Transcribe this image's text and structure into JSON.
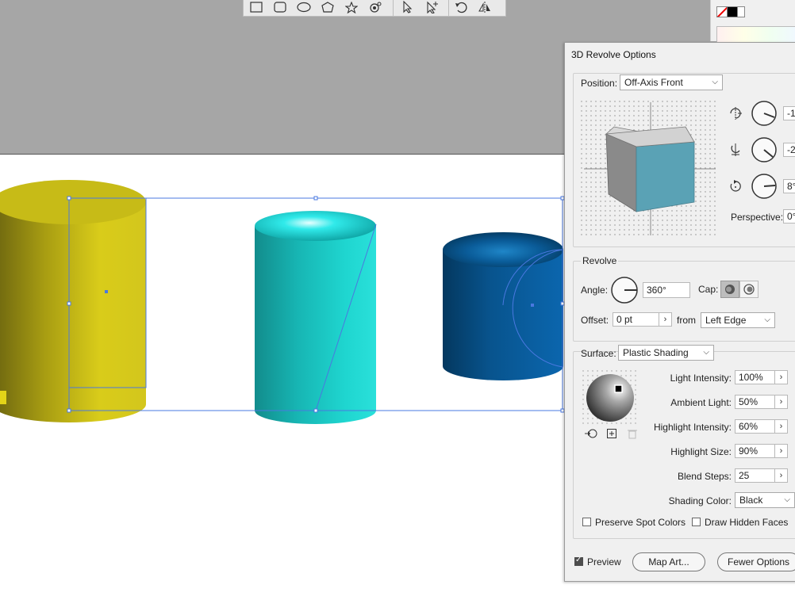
{
  "toolbar": {
    "tools": [
      {
        "icon": "rectangle-icon"
      },
      {
        "icon": "rounded-rectangle-icon"
      },
      {
        "icon": "ellipse-icon"
      },
      {
        "icon": "polygon-icon"
      },
      {
        "icon": "star-icon"
      },
      {
        "icon": "flare-icon"
      },
      {
        "icon": "selection-arrow-icon"
      },
      {
        "icon": "direct-selection-plus-icon"
      },
      {
        "icon": "rotate-icon"
      },
      {
        "icon": "reflect-icon"
      }
    ]
  },
  "swatches": {
    "fill": "none",
    "stroke": "#000000"
  },
  "colors": {
    "dialog_bg": "#f0f0f0",
    "cube_face": "#5aa2b5",
    "cylinder_yellow": "#d9cc1a",
    "cylinder_cyan": "#1fd6d0",
    "cylinder_blue": "#0b5fa0",
    "selection": "#4a78e0"
  },
  "dialog": {
    "title": "3D Revolve Options",
    "position": {
      "label": "Position:",
      "value": "Off-Axis Front",
      "x_rotation": "-1",
      "y_rotation": "-2",
      "z_rotation": "8°",
      "perspective_label": "Perspective:",
      "perspective_value": "0°"
    },
    "revolve": {
      "section_label": "Revolve",
      "angle_label": "Angle:",
      "angle_value": "360°",
      "cap_label": "Cap:",
      "offset_label": "Offset:",
      "offset_value": "0 pt",
      "from_label": "from",
      "from_value": "Left Edge"
    },
    "surface": {
      "label": "Surface:",
      "value": "Plastic Shading",
      "light_intensity_label": "Light Intensity:",
      "light_intensity_value": "100%",
      "ambient_light_label": "Ambient Light:",
      "ambient_light_value": "50%",
      "highlight_intensity_label": "Highlight Intensity:",
      "highlight_intensity_value": "60%",
      "highlight_size_label": "Highlight Size:",
      "highlight_size_value": "90%",
      "blend_steps_label": "Blend Steps:",
      "blend_steps_value": "25",
      "shading_color_label": "Shading Color:",
      "shading_color_value": "Black",
      "preserve_spot_colors_label": "Preserve Spot Colors",
      "preserve_spot_colors_checked": false,
      "draw_hidden_faces_label": "Draw Hidden Faces",
      "draw_hidden_faces_checked": false
    },
    "footer": {
      "preview_label": "Preview",
      "preview_checked": true,
      "map_art_label": "Map Art...",
      "fewer_options_label": "Fewer Options"
    }
  }
}
